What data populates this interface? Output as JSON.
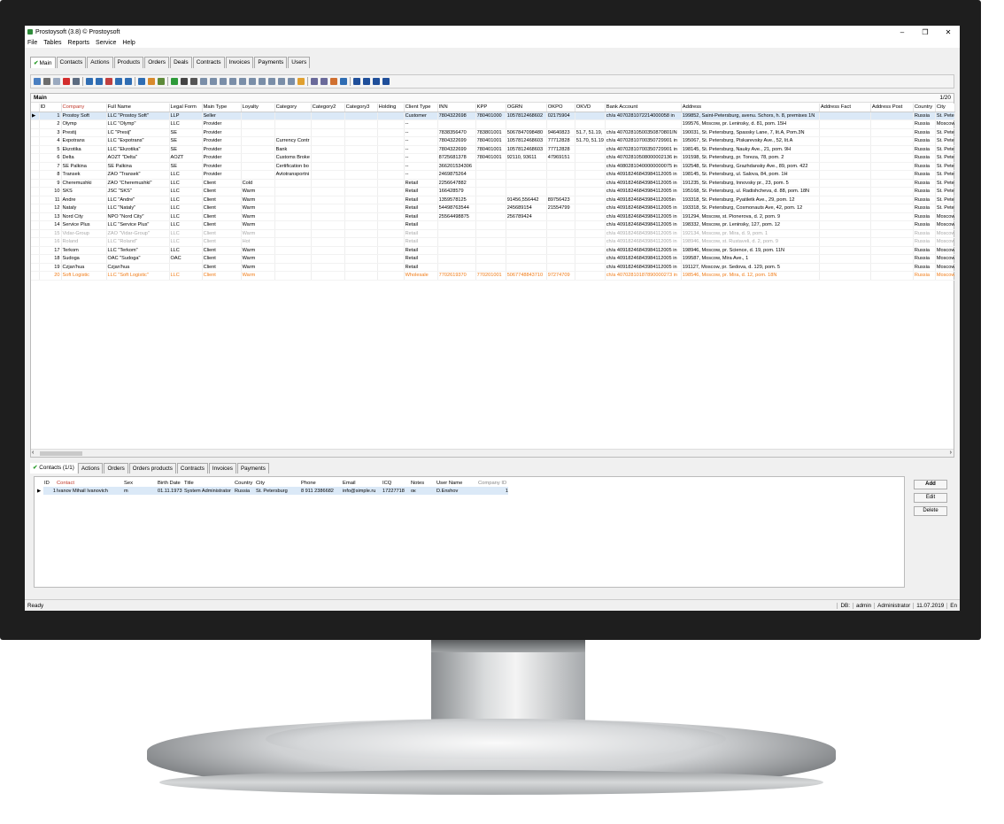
{
  "window": {
    "title": "Prostoysoft (3.8) © Prostoysoft",
    "min": "–",
    "restore": "❐",
    "close": "✕"
  },
  "menu": [
    "File",
    "Tables",
    "Reports",
    "Service",
    "Help"
  ],
  "tabs": [
    "Main",
    "Contacts",
    "Actions",
    "Products",
    "Orders",
    "Deals",
    "Contracts",
    "Invoices",
    "Payments",
    "Users"
  ],
  "grid": {
    "title": "Main",
    "record_count": "1/20",
    "columns": [
      "ID",
      "Company",
      "Full Name",
      "Legal Form",
      "Main Type",
      "Loyalty",
      "Category",
      "Category2",
      "Category3",
      "Holding",
      "Client Type",
      "INN",
      "KPP",
      "OGRN",
      "OKPO",
      "OKVD",
      "Bank Account",
      "Address",
      "Address Fact",
      "Address Post",
      "Country",
      "City"
    ],
    "rows": [
      [
        "1",
        "Prostoy Soft",
        "LLC \"Prostoy Soft\"",
        "LLP",
        "Seller",
        "",
        "",
        "",
        "",
        "",
        "Customer",
        "7804322698",
        "780401000",
        "1057812468602",
        "02175904",
        "",
        "ch/a 4070281072214000058 in",
        "199852, Saint-Petersburg, avenu. Schors, h. 8, premises 1N",
        "",
        "",
        "Russia",
        "St. Pete"
      ],
      [
        "2",
        "Olymp",
        "LLC \"Olymp\"",
        "LLC",
        "Provider",
        "",
        "",
        "",
        "",
        "",
        "--",
        "",
        "",
        "",
        "",
        "",
        "",
        "199576, Moscow, pr. Leninsky, d. 81, pom. 15H",
        "",
        "",
        "Russia",
        "Moscow"
      ],
      [
        "3",
        "Prestij",
        "LC \"Presij\"",
        "SE",
        "Provider",
        "",
        "",
        "",
        "",
        "",
        "--",
        "7838356470",
        "783801001",
        "5067847098480",
        "94640823",
        "51.7, 51.19,",
        "ch/a 40702810500350870801IN",
        "190031, St. Petersburg, Spassky Lane, 7, lit.A, Pom.3N",
        "",
        "",
        "Russia",
        "St. Pete"
      ],
      [
        "4",
        "Expotrans",
        "LLC \"Expotrans\"",
        "SE",
        "Provider",
        "",
        "Currency Contr",
        "",
        "",
        "",
        "--",
        "7804322699",
        "780401001",
        "1057812468603",
        "77712828",
        "51.70, 51.19",
        "ch/a 40702810700350729901 in",
        "195067, St. Petersburg, Piskarevsky Ave., 52, lit.A",
        "",
        "",
        "Russia",
        "St. Pete"
      ],
      [
        "5",
        "Ekzotika",
        "LLC \"Ekzotika\"",
        "SE",
        "Provider",
        "",
        "Bank",
        "",
        "",
        "",
        "--",
        "7804322699",
        "780401001",
        "1057812468603",
        "77712828",
        "",
        "ch/a 40702810700350729901 in",
        "198145, St. Petersburg, Nauky Ave., 21, pom. 9H",
        "",
        "",
        "Russia",
        "St. Pete"
      ],
      [
        "6",
        "Delta",
        "AOZT \"Delta\"",
        "AOZT",
        "Provider",
        "",
        "Customs Broke",
        "",
        "",
        "",
        "--",
        "8725681378",
        "780401001",
        "92110, 93611",
        "47969151",
        "",
        "ch/a 40702810508000002136 in",
        "191598, St. Petersburg, pr. Toreza, 78, pom. 2",
        "",
        "",
        "Russia",
        "St. Pete"
      ],
      [
        "7",
        "SE Palkina",
        "SE Palkina",
        "SE",
        "Provider",
        "",
        "Certification bo",
        "",
        "",
        "",
        "--",
        "366201534306",
        "",
        "",
        "",
        "",
        "ch/a 40802810400000000075 in",
        "192548, St. Petersburg, Grazhdansky Ave., 89, pom. 422",
        "",
        "",
        "Russia",
        "St. Pete"
      ],
      [
        "8",
        "Transek",
        "ZAO \"Transek\"",
        "LLC",
        "Provider",
        "",
        "Avtotransportni",
        "",
        "",
        "",
        "--",
        "2469875264",
        "",
        "",
        "",
        "",
        "ch/a 40918246843984112005 in",
        "198145, St. Petersburg, ul. Salova, 84, pom. 1H",
        "",
        "",
        "Russia",
        "St. Pete"
      ],
      [
        "9",
        "Cheremushki",
        "ZAO \"Cheremushki\"",
        "LLC",
        "Client",
        "Cold",
        "",
        "",
        "",
        "",
        "Retail",
        "2256647882",
        "",
        "",
        "",
        "",
        "ch/a 40918246843984112005 in",
        "191235, St. Petersburg, Innovsky pr., 23, pom. 5",
        "",
        "",
        "Russia",
        "St. Pete"
      ],
      [
        "10",
        "SKS",
        "JSC \"SKS\"",
        "LLC",
        "Client",
        "Warm",
        "",
        "",
        "",
        "",
        "Retail",
        "166428579",
        "",
        "",
        "",
        "",
        "ch/a 40918246843984112005 in",
        "195168, St. Petersburg, ul. Radishcheva, d. 88, pom. 18N",
        "",
        "",
        "Russia",
        "St. Pete"
      ],
      [
        "11",
        "Andre",
        "LLC \"Andre\"",
        "LLC",
        "Client",
        "Warm",
        "",
        "",
        "",
        "",
        "Retail",
        "1359578125",
        "",
        "91456,556442",
        "89756423",
        "",
        "ch/a 40918246843984112005in",
        "193318, St. Petersburg, Pyatiletk Ave., 29, pom. 12",
        "",
        "",
        "Russia",
        "St. Pete"
      ],
      [
        "12",
        "Nataly",
        "LLC \"Nataly\"",
        "LLC",
        "Client",
        "Warm",
        "",
        "",
        "",
        "",
        "Retail",
        "54498763544",
        "",
        "245689154",
        "21554799",
        "",
        "ch/a 40918246843984112005 in",
        "193318, St. Petersburg, Cosmonauts Ave, 42, pom. 12",
        "",
        "",
        "Russia",
        "St. Pete"
      ],
      [
        "13",
        "Nord City",
        "NPO \"Nord City\"",
        "LLC",
        "Client",
        "Warm",
        "",
        "",
        "",
        "",
        "Retail",
        "25564498875",
        "",
        "256789424",
        "",
        "",
        "ch/a 40918246843984112005 in",
        "191294, Moscow, st. Pionerova, d. 2, pom. 9",
        "",
        "",
        "Russia",
        "Moscow"
      ],
      [
        "14",
        "Service Plus",
        "LLC \"Service Plus\"",
        "LLC",
        "Client",
        "Warm",
        "",
        "",
        "",
        "",
        "Retail",
        "",
        "",
        "",
        "",
        "",
        "ch/a 40918246843984112005 in",
        "198332, Moscow, pr. Leninsky, 127, pom. 12",
        "",
        "",
        "Russia",
        "Moscow"
      ],
      [
        "15",
        "Vidar-Group",
        "ZAO \"Vidar-Group\"",
        "LLC",
        "Client",
        "Warm",
        "",
        "",
        "",
        "",
        "Retail",
        "",
        "",
        "",
        "",
        "",
        "ch/a 40918246843984112005 in",
        "192134, Moscow, pr. Mira, d. 9, pom. 1",
        "",
        "",
        "Russia",
        "Moscow"
      ],
      [
        "16",
        "Roland",
        "LLC \"Roland\"",
        "LLC",
        "Client",
        "Hot",
        "",
        "",
        "",
        "",
        "Retail",
        "",
        "",
        "",
        "",
        "",
        "ch/a 40918246843984112005 in",
        "198946, Moscow, st. Rustaveli, d. 2, pom. 9",
        "",
        "",
        "Russia",
        "Moscow"
      ],
      [
        "17",
        "Terkom",
        "LLC \"Terkom\"",
        "LLC",
        "Client",
        "Warm",
        "",
        "",
        "",
        "",
        "Retail",
        "",
        "",
        "",
        "",
        "",
        "ch/a 40918246843984112005 in",
        "198946, Moscow, pr. Science, d. 19, pom. 11N",
        "",
        "",
        "Russia",
        "Moscow"
      ],
      [
        "18",
        "Sudoga",
        "OAC \"Sudoga\"",
        "OAC",
        "Client",
        "Warm",
        "",
        "",
        "",
        "",
        "Retail",
        "",
        "",
        "",
        "",
        "",
        "ch/a 40918246843984112005 in",
        "199587, Moscow, Mira Ave., 1",
        "",
        "",
        "Russia",
        "Moscow"
      ],
      [
        "19",
        "Czjan'hua",
        "Czjan'hua",
        "",
        "Client",
        "Warm",
        "",
        "",
        "",
        "",
        "Retail",
        "",
        "",
        "",
        "",
        "",
        "ch/a 40918246843984112005 in",
        "191127, Moscow, pr. Sedova, d. 129, pom. 5",
        "",
        "",
        "Russia",
        "Moscow"
      ],
      [
        "20",
        "Soft Logistic",
        "LLC \"Soft Logistic\"",
        "LLC",
        "Client",
        "Warm",
        "",
        "",
        "",
        "",
        "Wholesale",
        "7702619370",
        "770201001",
        "5067748843710",
        "97274709",
        "",
        "ch/a 40702810187890000273 in",
        "198546, Moscow, pr. Mira, d. 12, pom. 18N",
        "",
        "",
        "Russia",
        "Moscow"
      ]
    ]
  },
  "subtabs": [
    "Contacts (1/1)",
    "Actions",
    "Orders",
    "Orders products",
    "Contracts",
    "Invoices",
    "Payments"
  ],
  "contacts": {
    "columns": [
      "ID",
      "Contact",
      "Sex",
      "Birth Date",
      "Title",
      "Country",
      "City",
      "Phone",
      "Email",
      "ICQ",
      "Notes",
      "User Name",
      "Company ID"
    ],
    "rows": [
      [
        "1",
        "Ivanov Mihail Ivanovich",
        "m",
        "01.11.1973",
        "System Administrator",
        "Russia",
        "St. Petersburg",
        "8 911 2386682",
        "info@simple.ru",
        "17227718",
        "ок",
        "D.Enshov",
        "1"
      ]
    ]
  },
  "buttons": {
    "add": "Add",
    "edit": "Edit",
    "delete": "Delete"
  },
  "status": {
    "text": "Ready",
    "db": "DB:",
    "user": "admin",
    "role": "Administrator",
    "date": "11.07.2019",
    "lang": "En"
  },
  "colors": {
    "accent_green": "#2a9c2a",
    "dim_row": "#a8a8a8",
    "highlight_row": "#f07b16",
    "selection": "#dbe9f7"
  }
}
